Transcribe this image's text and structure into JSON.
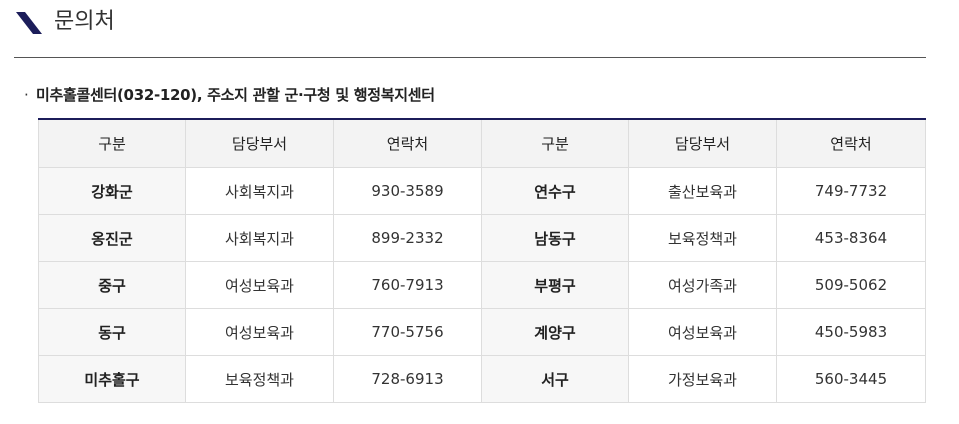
{
  "header": {
    "title": "문의처"
  },
  "intro": {
    "bullet": "·",
    "text": "미추홀콜센터(032-120), 주소지 관할 군·구청 및 행정복지센터"
  },
  "table": {
    "headers": [
      "구분",
      "담당부서",
      "연락처",
      "구분",
      "담당부서",
      "연락처"
    ],
    "rows": [
      [
        "강화군",
        "사회복지과",
        "930-3589",
        "연수구",
        "출산보육과",
        "749-7732"
      ],
      [
        "옹진군",
        "사회복지과",
        "899-2332",
        "남동구",
        "보육정책과",
        "453-8364"
      ],
      [
        "중구",
        "여성보육과",
        "760-7913",
        "부평구",
        "여성가족과",
        "509-5062"
      ],
      [
        "동구",
        "여성보육과",
        "770-5756",
        "계양구",
        "여성보육과",
        "450-5983"
      ],
      [
        "미추홀구",
        "보육정책과",
        "728-6913",
        "서구",
        "가정보육과",
        "560-3445"
      ]
    ]
  },
  "colors": {
    "accent": "#1c1d5a",
    "header_bg": "#f3f3f3",
    "rowhead_bg": "#f7f7f7",
    "border": "#dddddd"
  },
  "icons": {
    "header_mark": "slash-mark-icon"
  }
}
